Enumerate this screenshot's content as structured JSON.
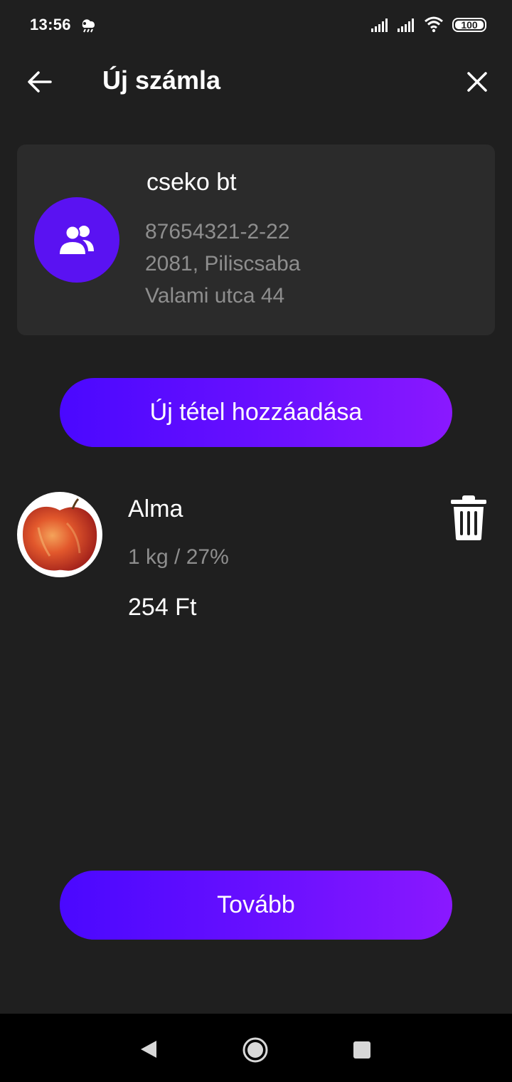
{
  "status_bar": {
    "time": "13:56",
    "battery": "100",
    "icons": [
      "weather-notification-icon",
      "signal-icon",
      "signal-icon",
      "wifi-icon",
      "battery-icon"
    ]
  },
  "header": {
    "title": "Új számla",
    "back_icon": "arrow-left-icon",
    "close_icon": "close-icon"
  },
  "customer": {
    "name": "cseko bt",
    "tax_number": "87654321-2-22",
    "city_line": "2081, Piliscsaba",
    "street_line": "Valami utca 44",
    "avatar_icon": "users-icon",
    "avatar_color": "#5a12f2"
  },
  "add_item_button": {
    "label": "Új tétel hozzáadása"
  },
  "items": [
    {
      "name": "Alma",
      "quantity_vat": "1 kg / 27%",
      "price": "254 Ft",
      "image_icon": "apple-image",
      "delete_icon": "trash-icon"
    }
  ],
  "next_button": {
    "label": "Tovább"
  },
  "colors": {
    "background": "#1f1f1f",
    "card": "#2b2b2b",
    "accent_start": "#4a08ff",
    "accent_end": "#8a18ff",
    "secondary_text": "#8e8e8e"
  },
  "nav_bar": {
    "icons": [
      "nav-back-icon",
      "nav-home-icon",
      "nav-recents-icon"
    ]
  }
}
